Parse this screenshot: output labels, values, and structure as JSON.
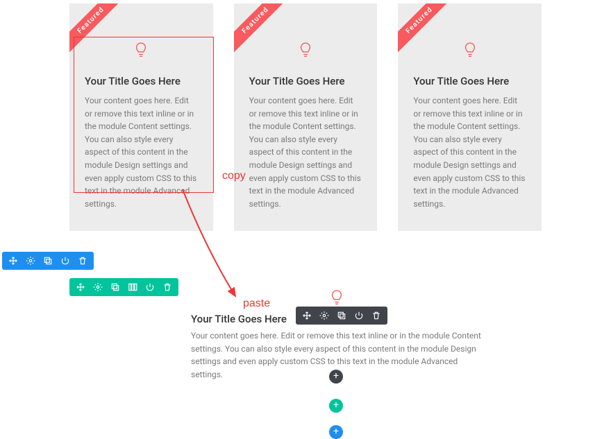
{
  "ribbon_label": "Featured",
  "cards": [
    {
      "title": "Your Title Goes Here",
      "body": "Your content goes here. Edit or remove this text inline or in the module Content settings. You can also style every aspect of this content in the module Design settings and even apply custom CSS to this text in the module Advanced settings."
    },
    {
      "title": "Your Title Goes Here",
      "body": "Your content goes here. Edit or remove this text inline or in the module Content settings. You can also style every aspect of this content in the module Design settings and even apply custom CSS to this text in the module Advanced settings."
    },
    {
      "title": "Your Title Goes Here",
      "body": "Your content goes here. Edit or remove this text inline or in the module Content settings. You can also style every aspect of this content in the module Design settings and even apply custom CSS to this text in the module Advanced settings."
    }
  ],
  "pasted": {
    "title": "Your Title Goes Here",
    "body": "Your content goes here. Edit or remove this text inline or in the module Content settings. You can also style every aspect of this content in the module Design settings and even apply custom CSS to this text in the module Advanced settings."
  },
  "annotations": {
    "copy": "copy",
    "paste": "paste"
  },
  "add_label": "+"
}
